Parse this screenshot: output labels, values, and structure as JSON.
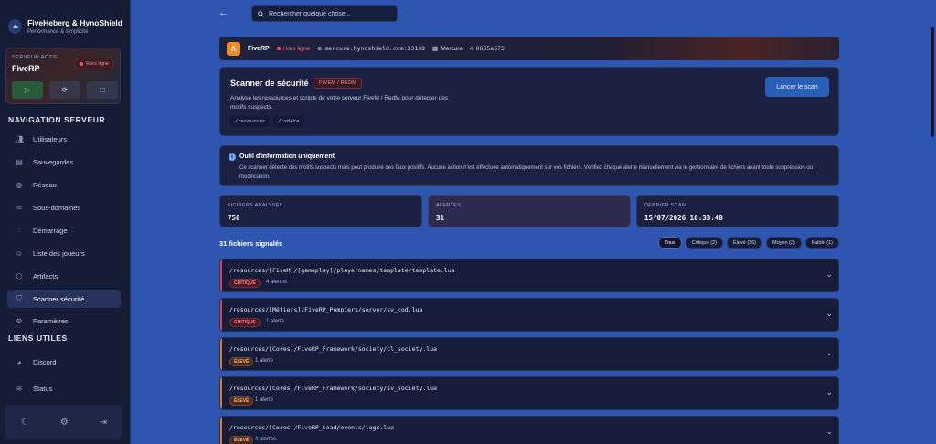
{
  "brand": {
    "title": "FiveHeberg & HynoShield",
    "subtitle": "Performance & simplicité"
  },
  "server_card": {
    "label": "SERVEUR ACTIF",
    "name": "FiveRP",
    "status": "Hors ligne"
  },
  "nav": {
    "heading": "NAVIGATION SERVEUR",
    "items": [
      {
        "label": "Utilisateurs",
        "icon": "users-icon"
      },
      {
        "label": "Sauvegardes",
        "icon": "backup-icon"
      },
      {
        "label": "Réseau",
        "icon": "globe-icon"
      },
      {
        "label": "Sous-domaines",
        "icon": "link-icon"
      },
      {
        "label": "Démarrage",
        "icon": "sliders-icon"
      },
      {
        "label": "Liste des joueurs",
        "icon": "players-icon"
      },
      {
        "label": "Artifacts",
        "icon": "box-icon"
      },
      {
        "label": "Scanner sécurité",
        "icon": "shield-icon"
      },
      {
        "label": "Paramètres",
        "icon": "gear-icon"
      }
    ],
    "links_heading": "LIENS UTILES",
    "links": [
      {
        "label": "Discord",
        "icon": "discord-icon"
      },
      {
        "label": "Status",
        "icon": "wifi-icon"
      }
    ]
  },
  "search": {
    "placeholder": "Rechercher quelque chose..."
  },
  "server_strip": {
    "name": "FiveRP",
    "status": "Hors ligne",
    "address": "mercure.hynoshield.com:33139",
    "node": "Mercure",
    "id": "0665a673"
  },
  "scanner": {
    "title": "Scanner de sécurité",
    "tag": "FIVEM / REDM",
    "description": "Analyse les ressources et scripts de votre serveur FiveM / RedM pour détecter des motifs suspects.",
    "paths": [
      "/resources",
      "/txdata"
    ],
    "button": "Lancer le scan"
  },
  "info": {
    "title": "Outil d'information uniquement",
    "text": "Ce scanner détecte des motifs suspects mais peut produire des faux positifs. Aucune action n'est effectuée automatiquement sur vos fichiers. Vérifiez chaque alerte manuellement via le gestionnaire de fichiers avant toute suppression ou modification."
  },
  "stats": [
    {
      "label": "FICHIERS ANALYSÉS",
      "value": "750"
    },
    {
      "label": "ALERTES",
      "value": "31"
    },
    {
      "label": "DERNIER SCAN",
      "value": "15/07/2026 10:33:48"
    }
  ],
  "results": {
    "count_label": "31 fichiers signalés",
    "filters": [
      "Tous",
      "Critique (2)",
      "Élevé (26)",
      "Moyen (2)",
      "Faible (1)"
    ],
    "files": [
      {
        "path": "/resources/[FiveM]/[gameplay]/playernames/template/template.lua",
        "severity": "CRITIQUE",
        "alerts": "4 alertes",
        "level": "crit"
      },
      {
        "path": "/resources/[Métiers]/FiveRP_Pompiers/server/sv_cod.lua",
        "severity": "CRITIQUE",
        "alerts": "1 alerte",
        "level": "crit"
      },
      {
        "path": "/resources/[Cores]/FiveRP_Framework/society/cl_society.lua",
        "severity": "ÉLEVÉ",
        "alerts": "1 alerte",
        "level": "high"
      },
      {
        "path": "/resources/[Cores]/FiveRP_Framework/society/sv_society.lua",
        "severity": "ÉLEVÉ",
        "alerts": "1 alerte",
        "level": "high"
      },
      {
        "path": "/resources/[Cores]/FiveRP_Load/events/logs.lua",
        "severity": "ÉLEVÉ",
        "alerts": "4 alertes",
        "level": "high"
      }
    ]
  },
  "colors": {
    "critical": "#e0404f",
    "high": "#e07a2a",
    "accent": "#2a5fb8"
  }
}
